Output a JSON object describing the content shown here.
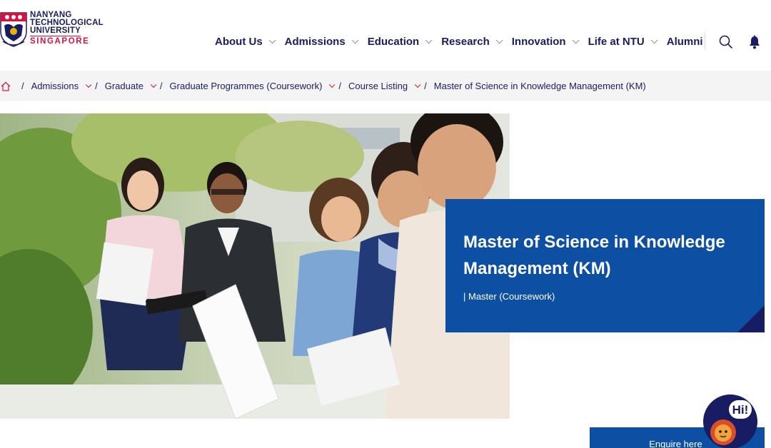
{
  "logo": {
    "line1": "NANYANG",
    "line2": "TECHNOLOGICAL",
    "line3": "UNIVERSITY",
    "line4": "SINGAPORE"
  },
  "nav": {
    "items": [
      {
        "label": "About Us",
        "dropdown": true
      },
      {
        "label": "Admissions",
        "dropdown": true
      },
      {
        "label": "Education",
        "dropdown": true
      },
      {
        "label": "Research",
        "dropdown": true
      },
      {
        "label": "Innovation",
        "dropdown": true
      },
      {
        "label": "Life at NTU",
        "dropdown": true
      },
      {
        "label": "Alumni",
        "dropdown": false
      }
    ],
    "search_icon": "search-icon",
    "bell_icon": "bell-icon"
  },
  "breadcrumb": {
    "home_icon": "home-icon",
    "separator": "/",
    "items": [
      {
        "label": "Admissions"
      },
      {
        "label": "Graduate"
      },
      {
        "label": "Graduate Programmes (Coursework)"
      },
      {
        "label": "Course Listing"
      }
    ],
    "current": "Master of Science in Knowledge Management (KM)"
  },
  "hero": {
    "title": "Master of Science in Knowledge Management (KM)",
    "subtitle": "| Master (Coursework)"
  },
  "enquire": {
    "label": "Enquire here"
  },
  "chatbot": {
    "bubble": "Hi!"
  },
  "colors": {
    "navy": "#181c62",
    "brand_blue": "#0c4fa3",
    "brand_red": "#d71440",
    "breadcrumb_bg": "#f4f4f4"
  }
}
